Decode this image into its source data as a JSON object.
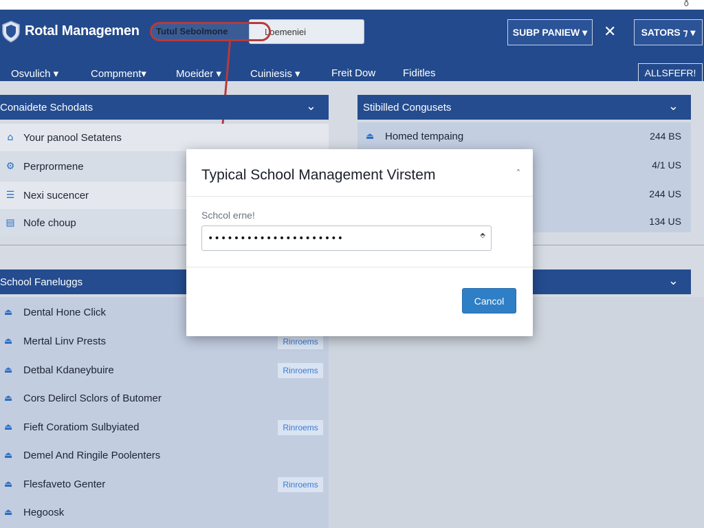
{
  "top_strip": {
    "corner_glyph": "ð"
  },
  "header": {
    "app_title": "Rotal Managemen",
    "highlight_text": "Tutul Sebolmone",
    "search_value": "Loemeniei",
    "buttons": {
      "subpanel": "SUBP PANIEW ▾",
      "sators": "SATORS ⁊ ▾",
      "allsfer": "ALLSFEFR!"
    },
    "close_glyph": "✕"
  },
  "nav": {
    "items": [
      {
        "label": "Osvulich ▾"
      },
      {
        "label": "Compment▾"
      },
      {
        "label": "Moeider ▾"
      },
      {
        "label": "Cuiniesis ▾"
      },
      {
        "label": "Freit Dow"
      },
      {
        "label": "Fiditles"
      }
    ]
  },
  "left_panel": {
    "title": "Conaidete Schodats",
    "rows": [
      {
        "icon": "home-icon",
        "glyph": "⌂",
        "label": "Your panool Setatens"
      },
      {
        "icon": "gear-icon",
        "glyph": "⚙",
        "label": "Perprormene"
      },
      {
        "icon": "list-icon",
        "glyph": "☰",
        "label": "Nexi sucencer"
      },
      {
        "icon": "chart-icon",
        "glyph": "▤",
        "label": "Nofe choup"
      }
    ]
  },
  "right_panel": {
    "title": "Stibilled Congusets",
    "rows": [
      {
        "icon": "user-icon",
        "glyph": "⏏",
        "label": "Homed tempaing",
        "amount": "244 BS"
      },
      {
        "label": "",
        "amount": "4/1 US"
      },
      {
        "label": "",
        "amount": "244 US"
      },
      {
        "label": "",
        "amount": "134 US"
      }
    ]
  },
  "left_panel_2": {
    "title": "School Faneluggs",
    "link_label": "Rinroems",
    "rows": [
      {
        "label": "Dental Hone Click",
        "link": false
      },
      {
        "label": "Mertal Linv Prests",
        "link": true
      },
      {
        "label": "Detbal Kdaneybuire",
        "link": true
      },
      {
        "label": "Cors Delircl Sclors of Butomer",
        "link": false
      },
      {
        "label": "Fieft Coratiom Sulbyiated",
        "link": true
      },
      {
        "label": "Demel And Ringile Poolenters",
        "link": false
      },
      {
        "label": "Flesfaveto Genter",
        "link": true
      },
      {
        "label": "Hegoosk",
        "link": false
      }
    ]
  },
  "modal": {
    "title": "Typical School Management Virstem",
    "close_glyph": "˄",
    "field_label": "Schcol erne!",
    "field_value": "•••••••••••••••••••••",
    "stepper_glyph": "⬘",
    "cancel_label": "Cancol"
  },
  "colors": {
    "header": "#234a8c",
    "accent": "#2f7fc6",
    "highlight": "#b83a3a"
  }
}
